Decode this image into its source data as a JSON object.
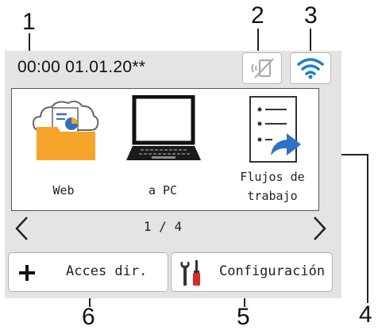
{
  "callouts": [
    "1",
    "2",
    "3",
    "4",
    "5",
    "6"
  ],
  "status_bar": {
    "datetime": "00:00  01.01.20**",
    "wifi_direct_icon": "wifi-direct-off-icon",
    "wifi_icon": "wifi-icon"
  },
  "tiles": [
    {
      "label": "Web",
      "icon": "web-cloud-folder-icon"
    },
    {
      "label": "a PC",
      "icon": "laptop-icon"
    },
    {
      "label_line1": "Flujos de",
      "label_line2": "trabajo",
      "icon": "workflow-list-icon"
    }
  ],
  "pager": {
    "text": "1 / 4"
  },
  "bottom_buttons": {
    "shortcuts": {
      "label": "Acces dir.",
      "icon": "plus-icon"
    },
    "settings": {
      "label": "Configuración",
      "icon": "tools-icon"
    }
  },
  "colors": {
    "screen_bg": "#e4e4e4",
    "folder_orange": "#f4a52a",
    "wifi_blue": "#1a7fd0",
    "arrow_blue": "#2b73c4",
    "screwdriver_red": "#d42a2a"
  }
}
